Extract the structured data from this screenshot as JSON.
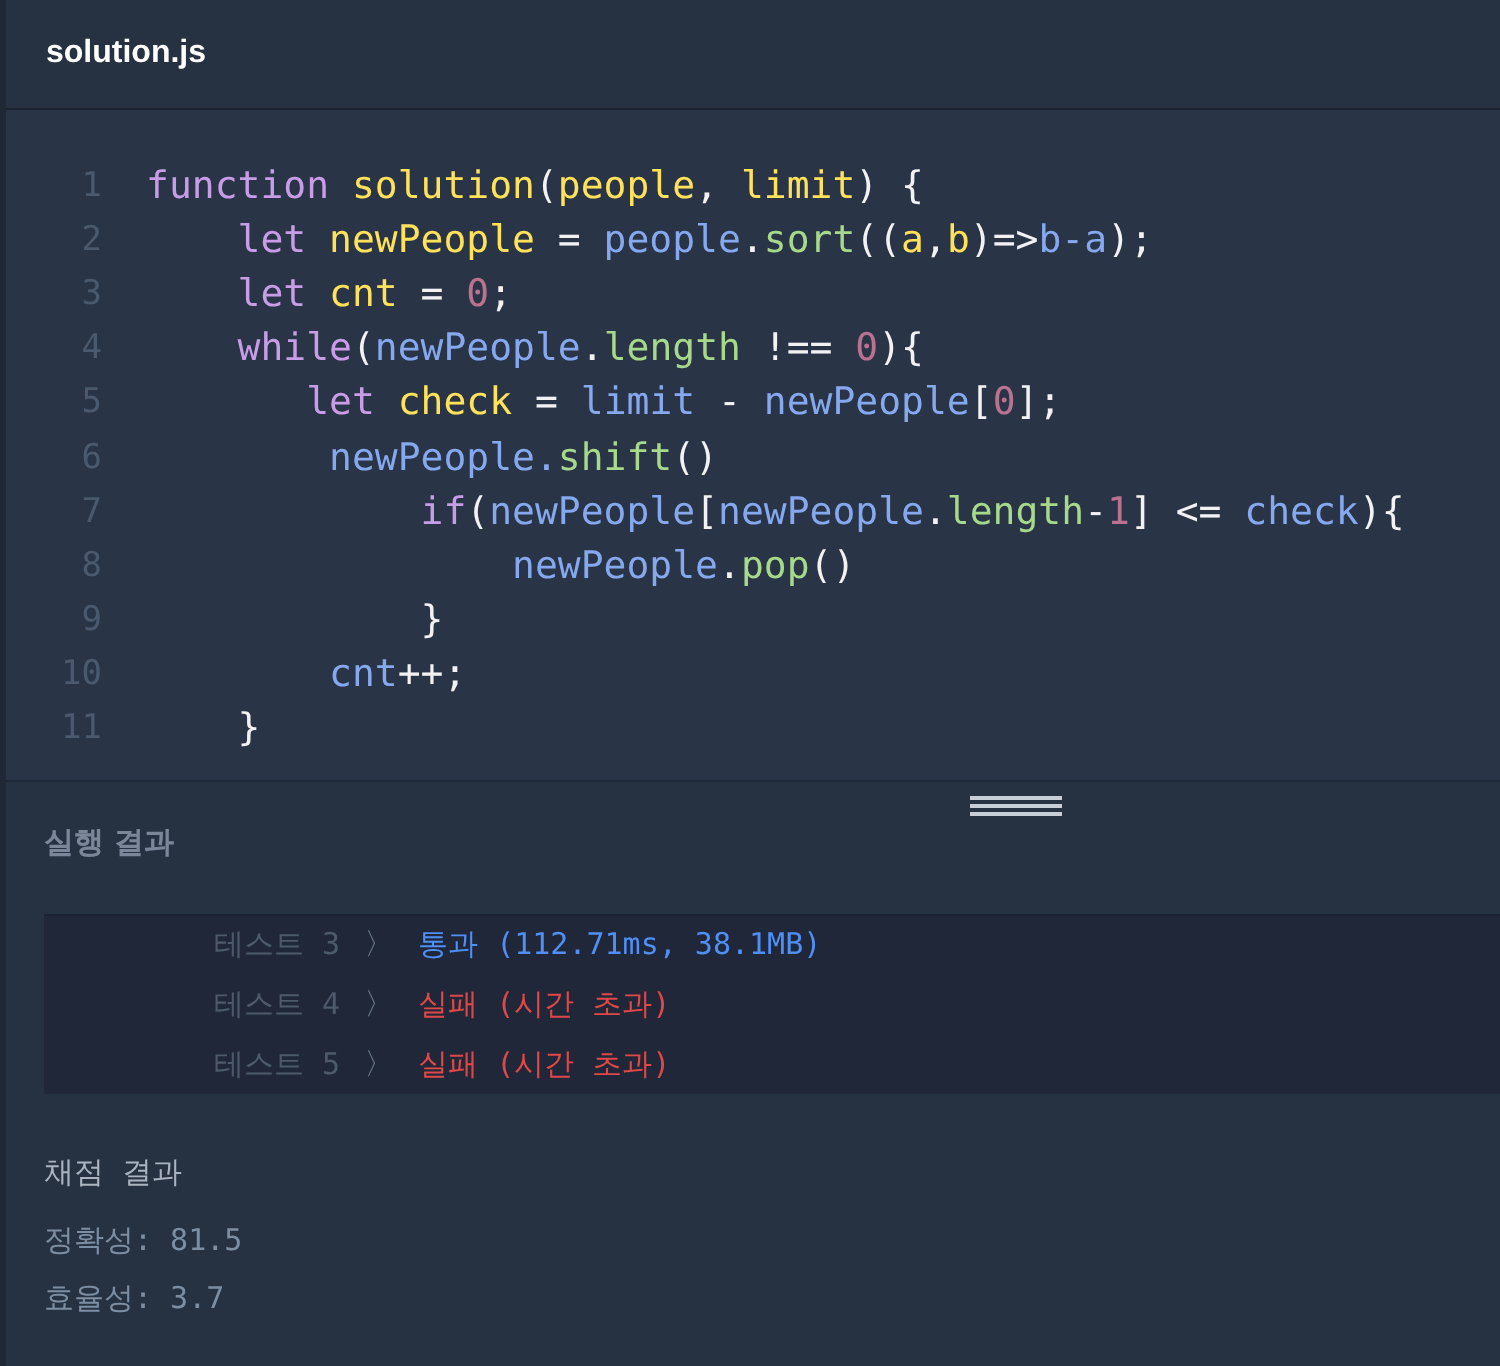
{
  "editor": {
    "title": "solution.js",
    "lines": [
      {
        "number": "1",
        "tokens": [
          {
            "kind": "keyword",
            "text": "function "
          },
          {
            "kind": "name",
            "text": "solution"
          },
          {
            "kind": "plain",
            "text": "("
          },
          {
            "kind": "name",
            "text": "people"
          },
          {
            "kind": "plain",
            "text": ", "
          },
          {
            "kind": "name",
            "text": "limit"
          },
          {
            "kind": "plain",
            "text": ") {"
          }
        ]
      },
      {
        "number": "2",
        "tokens": [
          {
            "kind": "keyword",
            "text": "    let "
          },
          {
            "kind": "name",
            "text": "newPeople"
          },
          {
            "kind": "plain",
            "text": " = "
          },
          {
            "kind": "variable",
            "text": "people"
          },
          {
            "kind": "plain",
            "text": "."
          },
          {
            "kind": "method",
            "text": "sort"
          },
          {
            "kind": "plain",
            "text": "(("
          },
          {
            "kind": "name",
            "text": "a"
          },
          {
            "kind": "plain",
            "text": ","
          },
          {
            "kind": "name",
            "text": "b"
          },
          {
            "kind": "plain",
            "text": ")=>"
          },
          {
            "kind": "variable",
            "text": "b-a"
          },
          {
            "kind": "plain",
            "text": ");"
          }
        ]
      },
      {
        "number": "3",
        "tokens": [
          {
            "kind": "keyword",
            "text": "    let "
          },
          {
            "kind": "name",
            "text": "cnt"
          },
          {
            "kind": "plain",
            "text": " = "
          },
          {
            "kind": "number",
            "text": "0"
          },
          {
            "kind": "plain",
            "text": ";"
          }
        ]
      },
      {
        "number": "4",
        "tokens": [
          {
            "kind": "keyword",
            "text": "    while"
          },
          {
            "kind": "plain",
            "text": "("
          },
          {
            "kind": "variable",
            "text": "newPeople"
          },
          {
            "kind": "plain",
            "text": "."
          },
          {
            "kind": "method",
            "text": "length"
          },
          {
            "kind": "plain",
            "text": " !== "
          },
          {
            "kind": "number",
            "text": "0"
          },
          {
            "kind": "plain",
            "text": "){"
          }
        ]
      },
      {
        "number": "5",
        "tokens": [
          {
            "kind": "keyword",
            "text": "       let "
          },
          {
            "kind": "name",
            "text": "check"
          },
          {
            "kind": "plain",
            "text": " = "
          },
          {
            "kind": "variable",
            "text": "limit"
          },
          {
            "kind": "plain",
            "text": " - "
          },
          {
            "kind": "variable",
            "text": "newPeople"
          },
          {
            "kind": "plain",
            "text": "["
          },
          {
            "kind": "number",
            "text": "0"
          },
          {
            "kind": "plain",
            "text": "];"
          }
        ]
      },
      {
        "number": "6",
        "tokens": [
          {
            "kind": "variable",
            "text": "        newPeople."
          },
          {
            "kind": "method",
            "text": "shift"
          },
          {
            "kind": "plain",
            "text": "()"
          }
        ]
      },
      {
        "number": "7",
        "tokens": [
          {
            "kind": "keyword",
            "text": "            if"
          },
          {
            "kind": "plain",
            "text": "("
          },
          {
            "kind": "variable",
            "text": "newPeople"
          },
          {
            "kind": "plain",
            "text": "["
          },
          {
            "kind": "variable",
            "text": "newPeople"
          },
          {
            "kind": "plain",
            "text": "."
          },
          {
            "kind": "method",
            "text": "length"
          },
          {
            "kind": "plain",
            "text": "-"
          },
          {
            "kind": "number",
            "text": "1"
          },
          {
            "kind": "plain",
            "text": "] <= "
          },
          {
            "kind": "variable",
            "text": "check"
          },
          {
            "kind": "plain",
            "text": "){"
          }
        ]
      },
      {
        "number": "8",
        "tokens": [
          {
            "kind": "variable",
            "text": "                newPeople"
          },
          {
            "kind": "plain",
            "text": "."
          },
          {
            "kind": "method",
            "text": "pop"
          },
          {
            "kind": "plain",
            "text": "()"
          }
        ]
      },
      {
        "number": "9",
        "tokens": [
          {
            "kind": "plain",
            "text": "            }"
          }
        ]
      },
      {
        "number": "10",
        "tokens": [
          {
            "kind": "variable",
            "text": "        cnt"
          },
          {
            "kind": "plain",
            "text": "++;"
          }
        ]
      },
      {
        "number": "11",
        "tokens": [
          {
            "kind": "plain",
            "text": "    }"
          }
        ]
      }
    ]
  },
  "results": {
    "title": "실행 결과",
    "tests": [
      {
        "label": "테스트 3",
        "chevron": "〉",
        "passed": true,
        "result": "통과 (112.71ms, 38.1MB)"
      },
      {
        "label": "테스트 4",
        "chevron": "〉",
        "passed": false,
        "result": "실패 (시간 초과)"
      },
      {
        "label": "테스트 5",
        "chevron": "〉",
        "passed": false,
        "result": "실패 (시간 초과)"
      }
    ]
  },
  "grading": {
    "title": "채점 결과",
    "scores": [
      "정확성: 81.5",
      "효율성: 3.7"
    ]
  }
}
